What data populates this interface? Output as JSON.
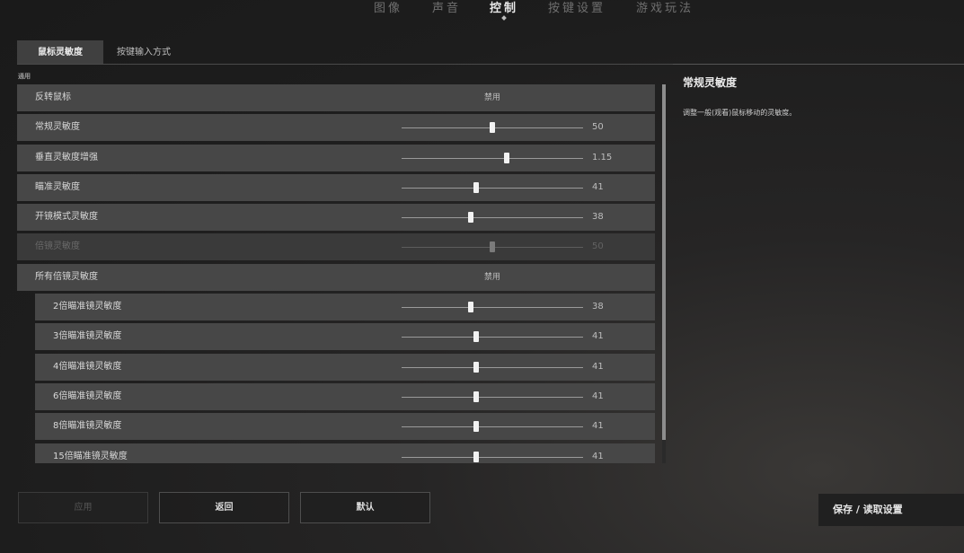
{
  "top_nav": {
    "tabs": [
      {
        "label": "图像",
        "active": false
      },
      {
        "label": "声音",
        "active": false
      },
      {
        "label": "控制",
        "active": true
      },
      {
        "label": "按键设置",
        "active": false
      },
      {
        "label": "游戏玩法",
        "active": false
      }
    ]
  },
  "sub_tabs": {
    "items": [
      {
        "label": "鼠标灵敏度",
        "active": true
      },
      {
        "label": "按键输入方式",
        "active": false
      }
    ]
  },
  "section_label": "通用",
  "settings": [
    {
      "label": "反转鼠标",
      "type": "toggle",
      "value": "禁用",
      "indent": false,
      "disabled": false
    },
    {
      "label": "常规灵敏度",
      "type": "slider",
      "value": "50",
      "fraction": 0.5,
      "indent": false,
      "disabled": false
    },
    {
      "label": "垂直灵敏度增强",
      "type": "slider",
      "value": "1.15",
      "fraction": 0.58,
      "indent": false,
      "disabled": false
    },
    {
      "label": "瞄准灵敏度",
      "type": "slider",
      "value": "41",
      "fraction": 0.41,
      "indent": false,
      "disabled": false
    },
    {
      "label": "开镜模式灵敏度",
      "type": "slider",
      "value": "38",
      "fraction": 0.38,
      "indent": false,
      "disabled": false
    },
    {
      "label": "倍镜灵敏度",
      "type": "slider",
      "value": "50",
      "fraction": 0.5,
      "indent": false,
      "disabled": true
    },
    {
      "label": "所有倍镜灵敏度",
      "type": "toggle",
      "value": "禁用",
      "indent": false,
      "disabled": false
    },
    {
      "label": "2倍瞄准镜灵敏度",
      "type": "slider",
      "value": "38",
      "fraction": 0.38,
      "indent": true,
      "disabled": false
    },
    {
      "label": "3倍瞄准镜灵敏度",
      "type": "slider",
      "value": "41",
      "fraction": 0.41,
      "indent": true,
      "disabled": false
    },
    {
      "label": "4倍瞄准镜灵敏度",
      "type": "slider",
      "value": "41",
      "fraction": 0.41,
      "indent": true,
      "disabled": false
    },
    {
      "label": "6倍瞄准镜灵敏度",
      "type": "slider",
      "value": "41",
      "fraction": 0.41,
      "indent": true,
      "disabled": false
    },
    {
      "label": "8倍瞄准镜灵敏度",
      "type": "slider",
      "value": "41",
      "fraction": 0.41,
      "indent": true,
      "disabled": false
    },
    {
      "label": "15倍瞄准镜灵敏度",
      "type": "slider",
      "value": "41",
      "fraction": 0.41,
      "indent": true,
      "disabled": false
    }
  ],
  "description": {
    "title": "常规灵敏度",
    "text": "调整一般(观看)鼠标移动的灵敏度。"
  },
  "buttons": {
    "apply": "应用",
    "back": "返回",
    "default": "默认",
    "save_load": "保存 / 读取设置"
  }
}
